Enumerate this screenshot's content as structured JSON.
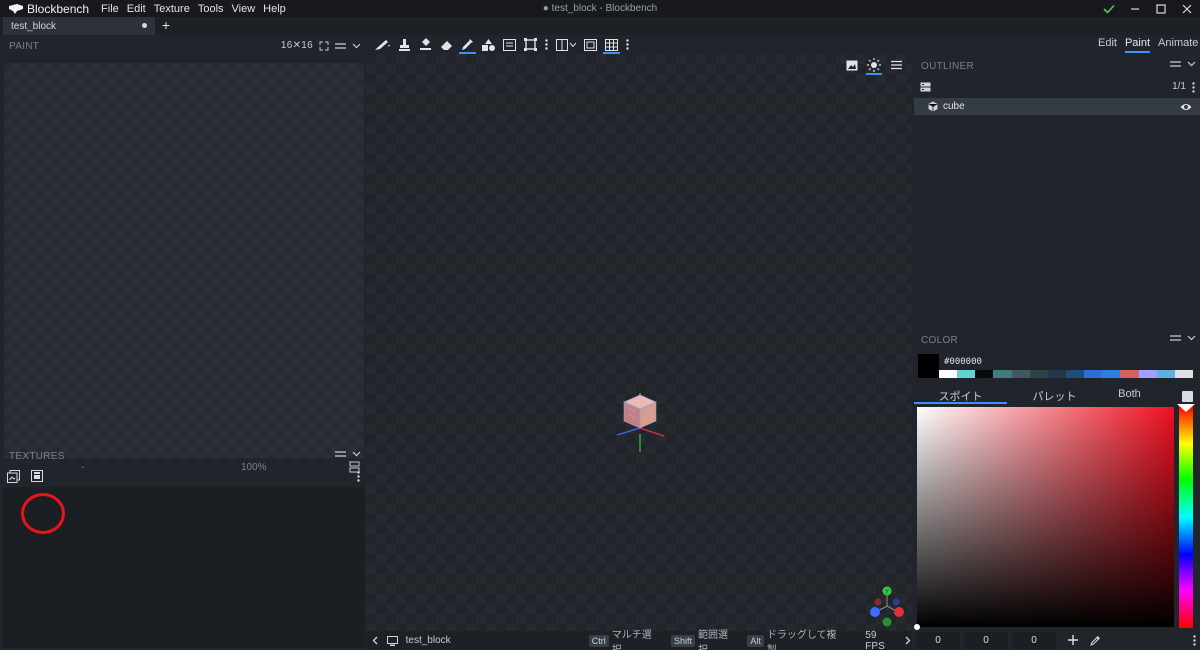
{
  "titlebar": {
    "app_name": "Blockbench",
    "menu": [
      "File",
      "Edit",
      "Texture",
      "Tools",
      "View",
      "Help"
    ],
    "window_title": "● test_block - Blockbench"
  },
  "tabs": {
    "active_label": "test_block",
    "add_label": "+"
  },
  "paint": {
    "header": "PAINT",
    "resolution": "16✕16",
    "footer_left": "-",
    "zoom": "100%"
  },
  "textures": {
    "header": "TEXTURES"
  },
  "modes": [
    "Edit",
    "Paint",
    "Animate"
  ],
  "active_mode": "Paint",
  "outliner": {
    "header": "OUTLINER",
    "count": "1/1",
    "items": [
      {
        "label": "cube"
      }
    ]
  },
  "color": {
    "header": "COLOR",
    "hex": "#000000",
    "tabs": [
      "スポイト",
      "パレット",
      "Both"
    ],
    "active_tab": "スポイト",
    "rgb": [
      "0",
      "0",
      "0"
    ],
    "palette": [
      "#ffffff",
      "#5fd3d3",
      "#0a0a0a",
      "#3f7c80",
      "#3e5a5e",
      "#2a4548",
      "#25364a",
      "#1d4d7a",
      "#2b6fd6",
      "#2f7fe0",
      "#d65f5f",
      "#a0a0ff",
      "#5fb0e0",
      "#e0e0e0"
    ],
    "accent": "#3e90ff"
  },
  "statusbar": {
    "project": "test_block",
    "hints": [
      {
        "key": "Ctrl",
        "text": "マルチ選択"
      },
      {
        "key": "Shift",
        "text": "範囲選択"
      },
      {
        "key": "Alt",
        "text": "ドラッグして複製"
      }
    ],
    "fps": "59 FPS"
  }
}
